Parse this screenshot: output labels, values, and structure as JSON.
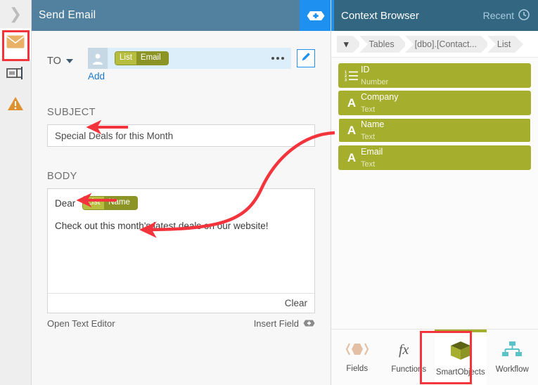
{
  "left_rail": {
    "collapse_icon": "chevron-right-icon",
    "items": [
      {
        "name": "email-step",
        "icon": "envelope-icon",
        "selected": true,
        "highlighted": true
      },
      {
        "name": "form-step",
        "icon": "form-input-icon",
        "selected": false,
        "highlighted": false
      },
      {
        "name": "warning-step",
        "icon": "warning-triangle-icon",
        "selected": false,
        "highlighted": false
      }
    ]
  },
  "email_panel": {
    "header": {
      "title": "Send Email",
      "add_icon": "plus-badge-icon",
      "add_button_color": "#1e90f0",
      "bar_color": "#5281a0"
    },
    "to": {
      "label": "TO",
      "dropdown_icon": "chevron-down-icon",
      "recipient_icon": "person-icon",
      "token": {
        "source": "List",
        "field": "Email"
      },
      "overflow_icon": "ellipsis-icon",
      "edit_icon": "pencil-icon",
      "add_link": "Add"
    },
    "subject": {
      "label": "SUBJECT",
      "value": "Special Deals for this Month",
      "placeholder": ""
    },
    "body": {
      "label": "BODY",
      "greeting": "Dear",
      "token": {
        "source": "List",
        "field": "Name"
      },
      "paragraph": "Check out this month's latest deals on our website!",
      "clear_label": "Clear",
      "open_editor_label": "Open Text Editor",
      "insert_field_label": "Insert Field",
      "insert_field_icon": "plus-badge-icon"
    }
  },
  "context_browser": {
    "header": {
      "title": "Context Browser",
      "recent_label": "Recent",
      "recent_icon": "clock-icon",
      "bar_color": "#336680",
      "accent_color": "#1e90f0"
    },
    "breadcrumbs": [
      {
        "label": "",
        "icon": "chevron-down-icon"
      },
      {
        "label": "Tables",
        "icon": ""
      },
      {
        "label": "[dbo].[Contact...",
        "icon": ""
      },
      {
        "label": "List",
        "icon": ""
      }
    ],
    "fields": [
      {
        "name": "ID",
        "type": "Number",
        "icon": "number-list-icon",
        "selected": false
      },
      {
        "name": "Company",
        "type": "Text",
        "icon": "text-a-icon",
        "selected": false
      },
      {
        "name": "Name",
        "type": "Text",
        "icon": "text-a-icon",
        "selected": true
      },
      {
        "name": "Email",
        "type": "Text",
        "icon": "text-a-icon",
        "selected": false
      }
    ],
    "field_color": "#a6ae2d",
    "toolbar": [
      {
        "label": "Fields",
        "icon": "fields-hex-icon",
        "active": false,
        "highlighted": false
      },
      {
        "label": "Functions",
        "icon": "fx-icon",
        "active": false,
        "highlighted": false
      },
      {
        "label": "SmartObjects",
        "icon": "cube-icon",
        "active": true,
        "highlighted": true
      },
      {
        "label": "Workflow",
        "icon": "workflow-tree-icon",
        "active": false,
        "highlighted": false
      }
    ]
  },
  "annotations": {
    "color": "#f4343c",
    "arrows": [
      {
        "name": "subject-arrow",
        "target": "SUBJECT"
      },
      {
        "name": "body-arrow",
        "target": "BODY"
      },
      {
        "name": "name-field-to-body-token-arrow",
        "target": "Name"
      }
    ],
    "highlight_boxes": [
      {
        "name": "email-step-highlight"
      },
      {
        "name": "smartobjects-tab-highlight"
      }
    ]
  }
}
